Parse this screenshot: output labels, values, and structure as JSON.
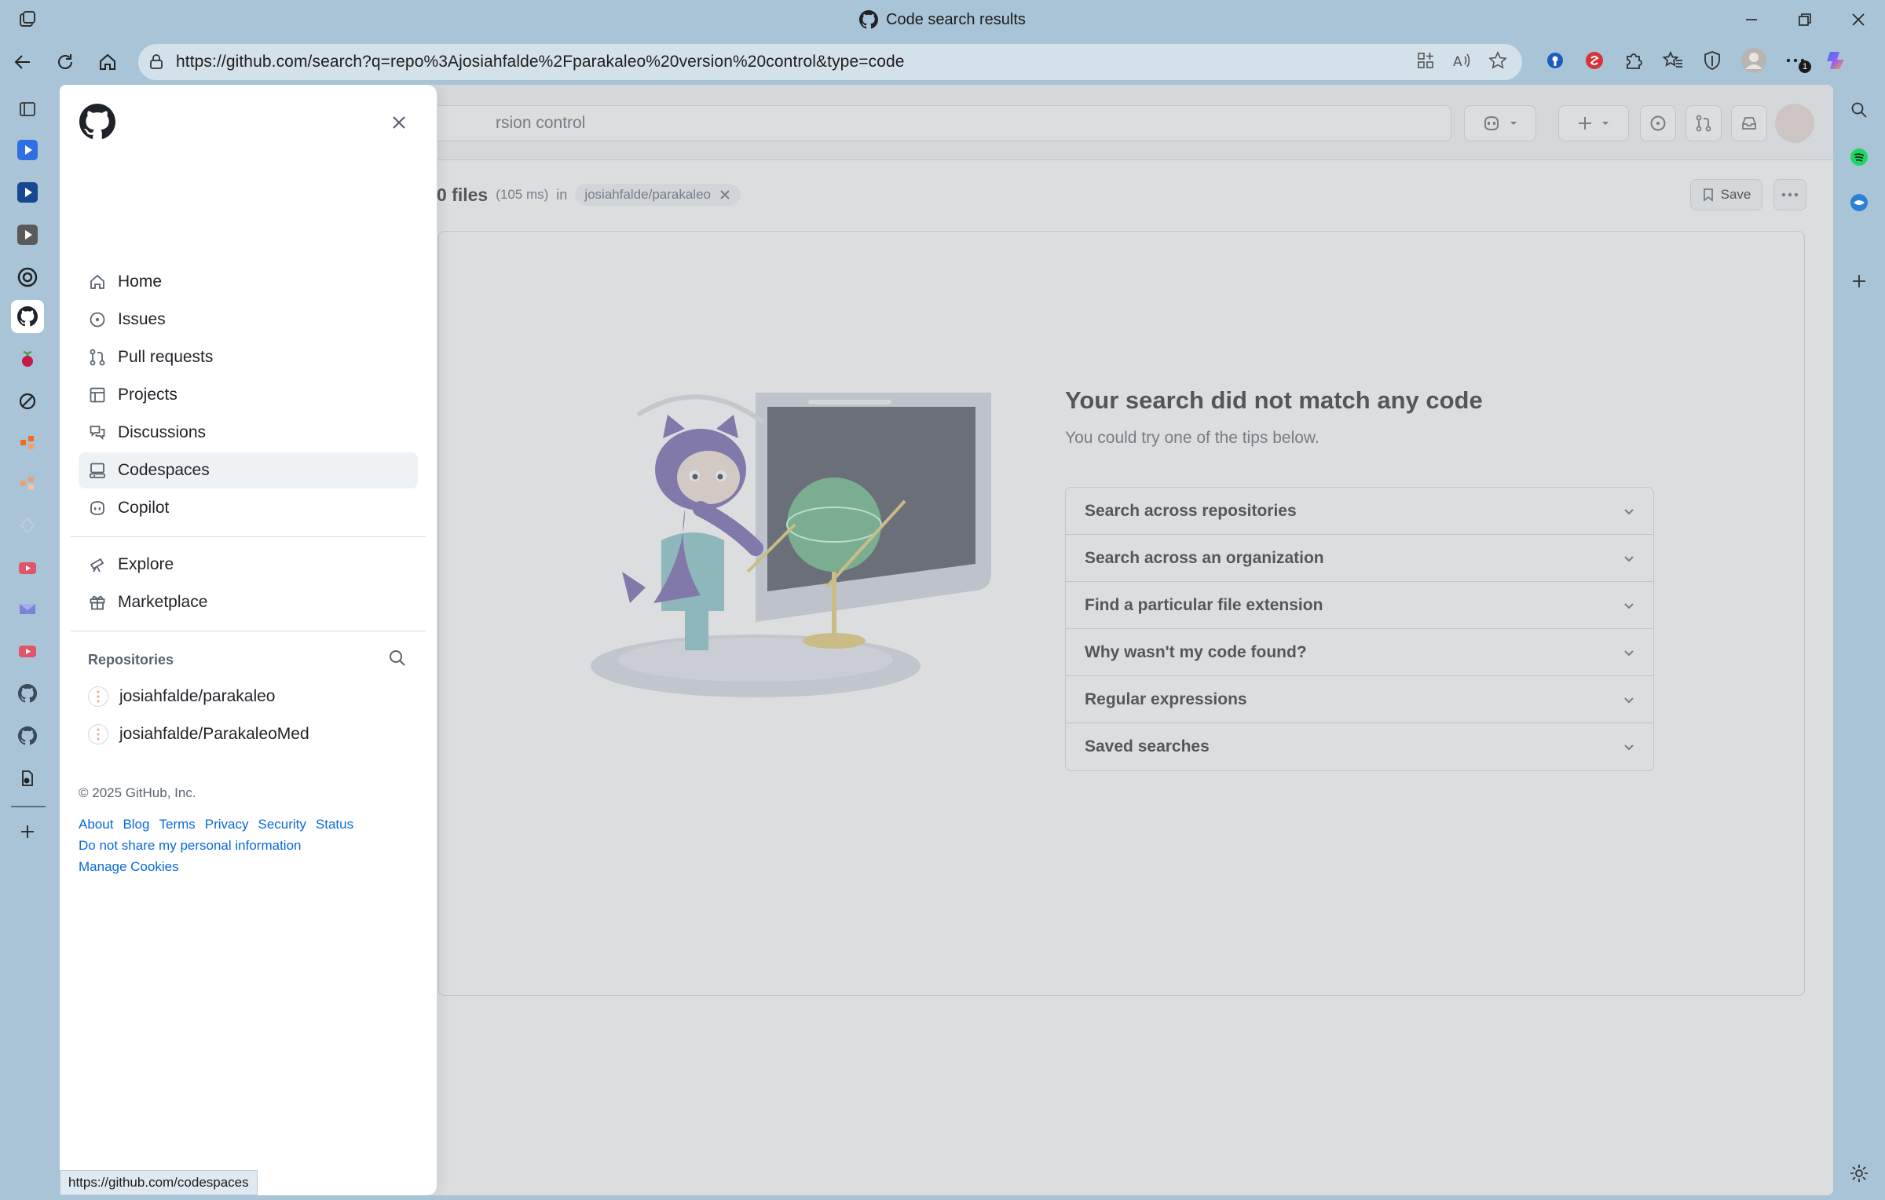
{
  "browser": {
    "window_title": "Code search results",
    "url": "https://github.com/search?q=repo%3Ajosiahfalde%2Fparakaleo%20version%20control&type=code",
    "status_url": "https://github.com/codespaces",
    "extension_badge": "1"
  },
  "header": {
    "search_text": "rsion control"
  },
  "results": {
    "count": "0 files",
    "time": "(105 ms)",
    "in_label": "in",
    "repo_filter": "josiahfalde/parakaleo",
    "save_label": "Save"
  },
  "empty_state": {
    "title": "Your search did not match any code",
    "subtitle": "You could try one of the tips below.",
    "tips": [
      "Search across repositories",
      "Search across an organization",
      "Find a particular file extension",
      "Why wasn't my code found?",
      "Regular expressions",
      "Saved searches"
    ]
  },
  "drawer": {
    "nav": [
      {
        "label": "Home",
        "icon": "home-icon"
      },
      {
        "label": "Issues",
        "icon": "issue-icon"
      },
      {
        "label": "Pull requests",
        "icon": "pull-request-icon"
      },
      {
        "label": "Projects",
        "icon": "table-icon"
      },
      {
        "label": "Discussions",
        "icon": "comment-discussion-icon"
      },
      {
        "label": "Codespaces",
        "icon": "codespaces-icon"
      },
      {
        "label": "Copilot",
        "icon": "copilot-icon"
      }
    ],
    "nav2": [
      {
        "label": "Explore",
        "icon": "telescope-icon"
      },
      {
        "label": "Marketplace",
        "icon": "gift-icon"
      }
    ],
    "repositories_heading": "Repositories",
    "repositories": [
      "josiahfalde/parakaleo",
      "josiahfalde/ParakaleoMed"
    ],
    "copyright": "© 2025 GitHub, Inc.",
    "footer_links": [
      "About",
      "Blog",
      "Terms",
      "Privacy",
      "Security",
      "Status",
      "Do not share my personal information",
      "Manage Cookies"
    ]
  },
  "colors": {
    "accent_link": "#0969da",
    "active_nav_bg": "#eff2f5",
    "browser_frame": "#a9c4d6"
  }
}
